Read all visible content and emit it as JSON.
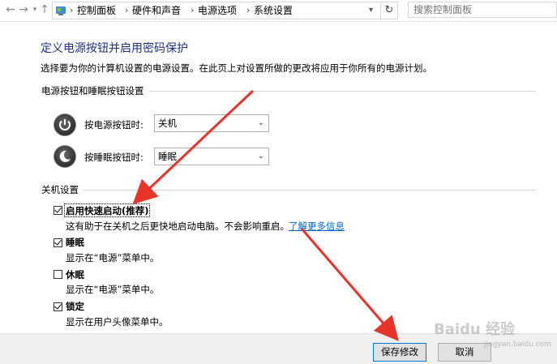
{
  "nav": {
    "back_icon": "back-arrow-icon",
    "forward_icon": "forward-arrow-icon",
    "recent_icon": "chevron-down-icon",
    "up_icon": "up-arrow-icon"
  },
  "breadcrumb": {
    "items": [
      "控制面板",
      "硬件和声音",
      "电源选项",
      "系统设置"
    ],
    "separator": "›"
  },
  "search": {
    "placeholder": "搜索控制面板"
  },
  "page": {
    "title": "定义电源按钮并启用密码保护",
    "description": "选择要为你的计算机设置的电源设置。在此页上对设置所做的更改将应用于你所有的电源计划。"
  },
  "power_buttons": {
    "group_label": "电源按钮和睡眠按钮设置",
    "power": {
      "label": "按电源按钮时:",
      "value": "关机"
    },
    "sleep": {
      "label": "按睡眠按钮时:",
      "value": "睡眠"
    }
  },
  "shutdown": {
    "group_label": "关机设置",
    "options": [
      {
        "label": "启用快速启动(推荐)",
        "checked": true,
        "desc": "这有助于在关机之后更快地启动电脑。不会影响重启。",
        "link": "了解更多信息"
      },
      {
        "label": "睡眠",
        "checked": true,
        "desc": "显示在“电源”菜单中。"
      },
      {
        "label": "休眠",
        "checked": false,
        "desc": "显示在“电源”菜单中。"
      },
      {
        "label": "锁定",
        "checked": true,
        "desc": "显示在用户头像菜单中。"
      }
    ]
  },
  "buttons": {
    "save": "保存修改",
    "cancel": "取消"
  },
  "watermark": {
    "text": "Baidu 经验",
    "url": "jingyan.baidu.com"
  },
  "colors": {
    "title": "#1e3287",
    "link": "#0066cc",
    "annotation_arrow": "#e8332a"
  }
}
